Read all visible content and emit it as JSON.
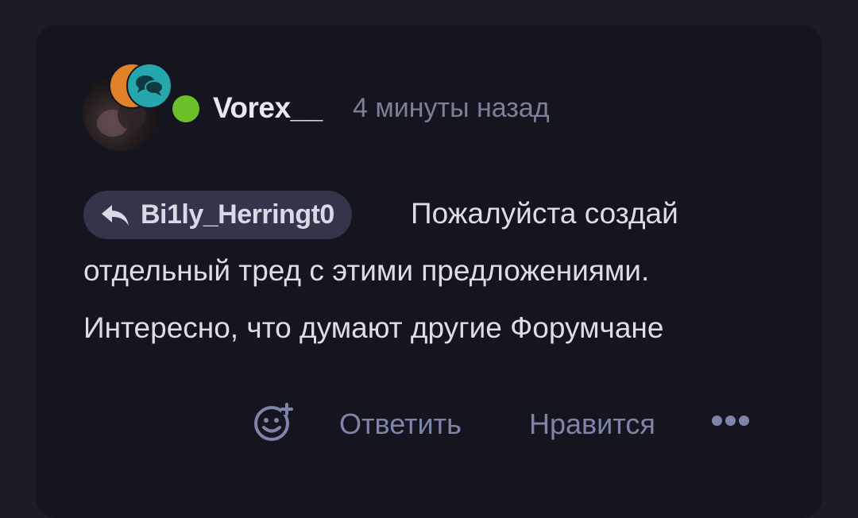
{
  "post": {
    "author": {
      "username": "Vorex__",
      "online": true
    },
    "timestamp": "4 минуты назад",
    "reply_to": {
      "username": "Bi1ly_Herringt0"
    },
    "body_lines": [
      "Пожалуйста создай",
      "отдельный тред с этими предложениями.",
      "Интересно, что думают другие Форумчане"
    ],
    "actions": {
      "react_icon": "smiley-plus-icon",
      "reply_label": "Ответить",
      "like_label": "Нравится",
      "more_icon": "more-dots-icon"
    }
  },
  "colors": {
    "background": "#1b1c26",
    "card": "#151520",
    "online": "#6cc12a",
    "badge_orange": "#e0822a",
    "badge_teal": "#26a6ad",
    "muted_text": "#7b8097",
    "action_text": "#7d86a8",
    "chip_bg": "#33354a"
  }
}
